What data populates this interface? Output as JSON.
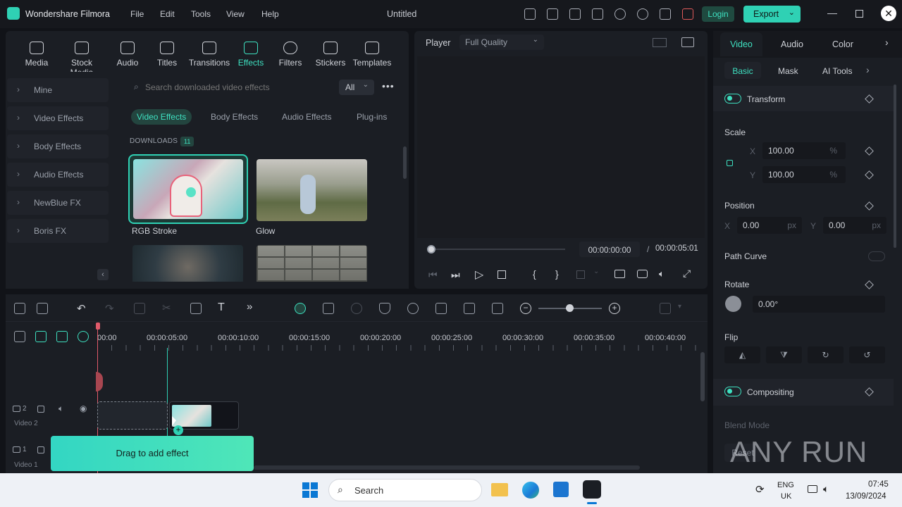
{
  "app": {
    "name": "Wondershare Filmora",
    "title": "Untitled",
    "menu": [
      "File",
      "Edit",
      "Tools",
      "View",
      "Help"
    ],
    "login_label": "Login",
    "export_label": "Export"
  },
  "toolbar": {
    "items": [
      "Media",
      "Stock Media",
      "Audio",
      "Titles",
      "Transitions",
      "Effects",
      "Filters",
      "Stickers",
      "Templates"
    ],
    "active": "Effects"
  },
  "effects": {
    "sidebar": [
      "Mine",
      "Video Effects",
      "Body Effects",
      "Audio Effects",
      "NewBlue FX",
      "Boris FX"
    ],
    "search_placeholder": "Search downloaded video effects",
    "filter_value": "All",
    "tabs": [
      "Video Effects",
      "Body Effects",
      "Audio Effects",
      "Plug-ins"
    ],
    "downloads_label": "DOWNLOADS",
    "downloads_count": "11",
    "cards": [
      {
        "name": "RGB Stroke"
      },
      {
        "name": "Glow"
      }
    ]
  },
  "player": {
    "label": "Player",
    "quality": "Full Quality",
    "current_time": "00:00:00:00",
    "total_time": "00:00:05:01",
    "separator": "/"
  },
  "props": {
    "tabs": [
      "Video",
      "Audio",
      "Color"
    ],
    "subtabs": [
      "Basic",
      "Mask",
      "AI Tools"
    ],
    "transform_label": "Transform",
    "scale_label": "Scale",
    "scale_x_label": "X",
    "scale_x": "100.00",
    "scale_y_label": "Y",
    "scale_y": "100.00",
    "percent": "%",
    "position_label": "Position",
    "pos_x_label": "X",
    "pos_x": "0.00",
    "pos_y_label": "Y",
    "pos_y": "0.00",
    "px": "px",
    "path_curve_label": "Path Curve",
    "rotate_label": "Rotate",
    "rotate_value": "0.00°",
    "flip_label": "Flip",
    "compositing_label": "Compositing",
    "blend_mode_label": "Blend Mode",
    "reset_label": "Reset"
  },
  "timeline": {
    "ticks": [
      "00:00",
      "00:00:05:00",
      "00:00:10:00",
      "00:00:15:00",
      "00:00:20:00",
      "00:00:25:00",
      "00:00:30:00",
      "00:00:35:00",
      "00:00:40:00"
    ],
    "track2_label": "Video 2",
    "track2_num": "2",
    "track1_label": "Video 1",
    "track1_num": "1",
    "drag_hint": "Drag to add effect"
  },
  "watermark": "ANY RUN",
  "taskbar": {
    "search_placeholder": "Search",
    "lang": "ENG",
    "region": "UK",
    "time": "07:45",
    "date": "13/09/2024"
  }
}
